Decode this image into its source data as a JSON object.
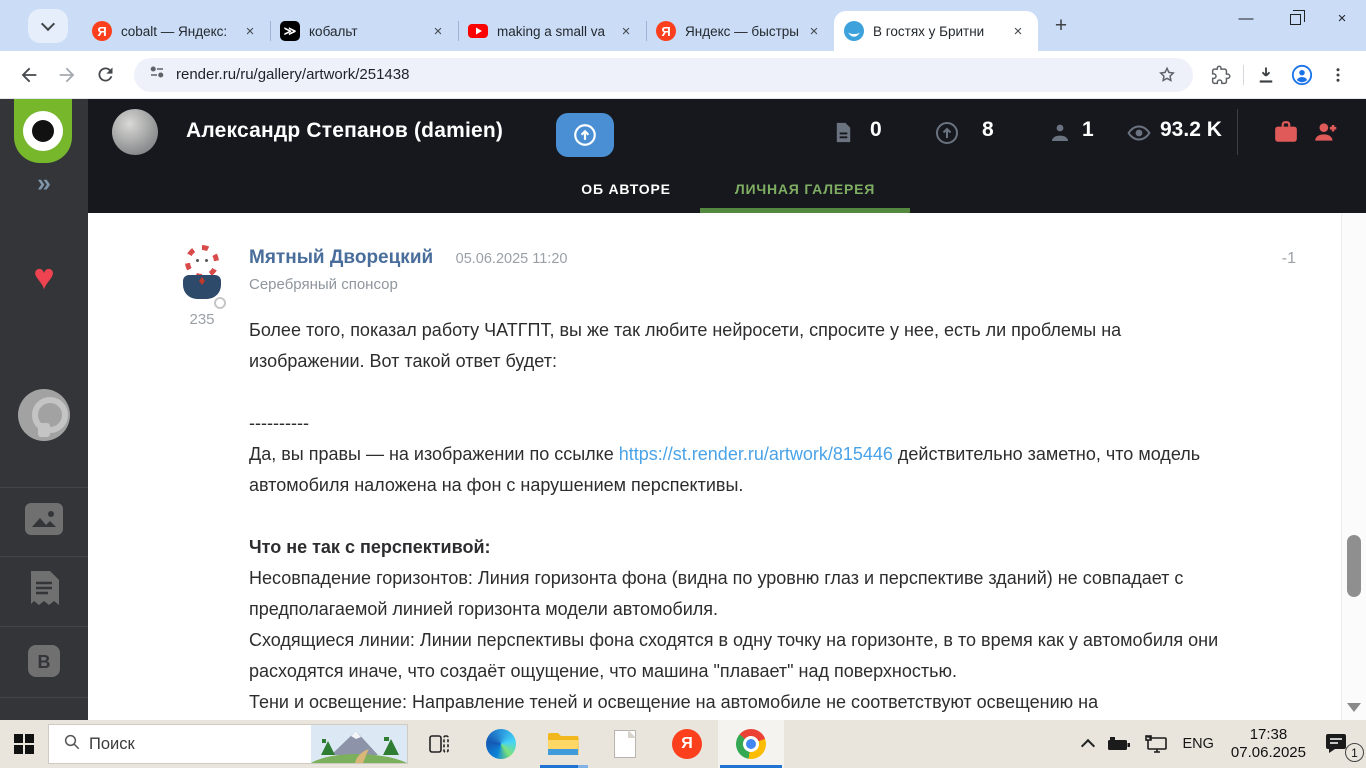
{
  "glyphs": {
    "tab_close": "×",
    "new_tab": "+",
    "minimize": "—",
    "close_window": "×",
    "sidebar_expand": "»",
    "favorites": "♥",
    "yandex_letter": "Я",
    "cobalt_mark": "≫",
    "blog_letter": "B"
  },
  "browser": {
    "tabs": [
      {
        "title": "cobalt — Яндекс:",
        "favicon": "yandex-icon"
      },
      {
        "title": "кобальт",
        "favicon": "cobalt-icon"
      },
      {
        "title": "making a small va",
        "favicon": "youtube-icon"
      },
      {
        "title": "Яндекс — быстры",
        "favicon": "yandex-icon"
      },
      {
        "title": "В гостях у Бритни",
        "favicon": "britni-icon"
      }
    ],
    "url": "render.ru/ru/gallery/artwork/251438"
  },
  "site": {
    "author_name": "Александр Степанов (damien)",
    "stats": {
      "posts": "0",
      "rating": "8",
      "subscribers": "1",
      "views": "93.2 K"
    },
    "tabs": {
      "about": "ОБ АВТОРЕ",
      "gallery": "ЛИЧНАЯ ГАЛЕРЕЯ"
    }
  },
  "comment": {
    "author": "Мятный Дворецкий",
    "timestamp": "05.06.2025 11:20",
    "author_status": "Серебряный спонсор",
    "author_karma": "235",
    "rating": "-1",
    "p1": "Более того, показал работу ЧАТГПТ, вы же так любите нейросети, спросите у нее, есть ли проблемы на изображении. Вот такой ответ будет:",
    "divider": "----------",
    "p2_before_link": "Да, вы правы — на изображении по ссылке ",
    "p2_link": "https://st.render.ru/artwork/815446",
    "p2_after_link": " действительно заметно, что модель автомобиля наложена на фон с нарушением перспективы.",
    "heading": "Что не так с перспективой:",
    "p3": "Несовпадение горизонтов: Линия горизонта фона (видна по уровню глаз и перспективе зданий) не совпадает с предполагаемой линией горизонта модели автомобиля.",
    "p4": "Сходящиеся линии: Линии перспективы фона сходятся в одну точку на горизонте, в то время как у автомобиля они расходятся иначе, что создаёт ощущение, что машина \"плавает\" над поверхностью.",
    "p5": "Тени и освещение: Направление теней и освещение на автомобиле не соответствуют освещению на"
  },
  "taskbar": {
    "search_label": "Поиск",
    "language": "ENG",
    "time": "17:38",
    "date": "07.06.2025",
    "notification_count": "1"
  }
}
